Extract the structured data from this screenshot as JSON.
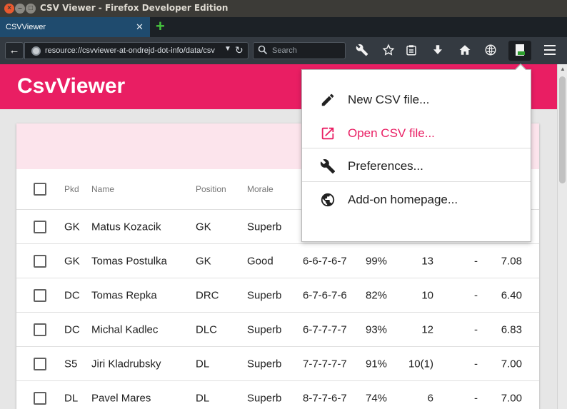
{
  "window": {
    "title": "CSV Viewer - Firefox Developer Edition",
    "controls": [
      "close-icon",
      "minimize-icon",
      "maximize-icon"
    ]
  },
  "tabs": [
    {
      "label": "CSVViewer",
      "close": "✕"
    }
  ],
  "new_tab": "+",
  "navbar": {
    "url": "resource://csvviewer-at-ondrejd-dot-info/data/csv",
    "search_placeholder": "Search",
    "icons": [
      "back-icon",
      "site-identity-icon",
      "url-dropdown-icon",
      "reload-icon",
      "search-icon",
      "wrench-icon",
      "bookmark-star-icon",
      "reading-list-icon",
      "download-icon",
      "home-icon",
      "developer-globe-icon",
      "csv-viewer-addon-icon",
      "hamburger-menu-icon"
    ]
  },
  "app": {
    "title": "CsvViewer",
    "accent": "#e91e63",
    "accent_light": "#fce4ec"
  },
  "table": {
    "headers": [
      "Pkd",
      "Name",
      "Position",
      "Morale"
    ],
    "rows": [
      [
        "GK",
        "Matus Kozacik",
        "GK",
        "Superb",
        "",
        "",
        "",
        "",
        ""
      ],
      [
        "GK",
        "Tomas Postulka",
        "GK",
        "Good",
        "6-6-7-6-7",
        "99%",
        "13",
        "-",
        "7.08"
      ],
      [
        "DC",
        "Tomas Repka",
        "DRC",
        "Superb",
        "6-7-6-7-6",
        "82%",
        "10",
        "-",
        "6.40"
      ],
      [
        "DC",
        "Michal Kadlec",
        "DLC",
        "Superb",
        "6-7-7-7-7",
        "93%",
        "12",
        "-",
        "6.83"
      ],
      [
        "S5",
        "Jiri Kladrubsky",
        "DL",
        "Superb",
        "7-7-7-7-7",
        "91%",
        "10(1)",
        "-",
        "7.00"
      ],
      [
        "DL",
        "Pavel Mares",
        "DL",
        "Superb",
        "8-7-7-6-7",
        "74%",
        "6",
        "-",
        "7.00"
      ]
    ]
  },
  "menu": {
    "items": [
      {
        "label": "New CSV file...",
        "icon": "pencil-icon"
      },
      {
        "label": "Open CSV file...",
        "icon": "open-in-new-icon",
        "accent": true
      },
      {
        "label": "Preferences...",
        "icon": "wrench-icon"
      },
      {
        "label": "Add-on homepage...",
        "icon": "globe-icon"
      }
    ]
  }
}
